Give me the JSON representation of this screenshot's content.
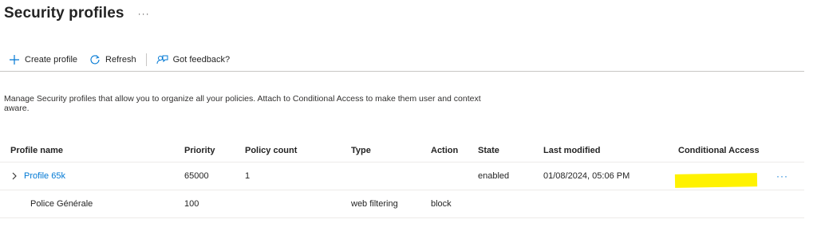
{
  "page": {
    "title": "Security profiles",
    "more_label": "···"
  },
  "toolbar": {
    "create_label": "Create profile",
    "refresh_label": "Refresh",
    "feedback_label": "Got feedback?"
  },
  "description": "Manage Security profiles that allow you to organize all your policies. Attach to Conditional Access to make them user and context aware.",
  "table": {
    "columns": [
      "Profile name",
      "Priority",
      "Policy count",
      "Type",
      "Action",
      "State",
      "Last modified",
      "Conditional Access"
    ],
    "rows": [
      {
        "name": "Profile 65k",
        "priority": "65000",
        "policy_count": "1",
        "type": "",
        "action": "",
        "state": "enabled",
        "last_modified": "01/08/2024, 05:06 PM",
        "conditional_access": "",
        "more_label": "···"
      },
      {
        "name": "Police Générale",
        "priority": "100",
        "policy_count": "",
        "type": "web filtering",
        "action": "block",
        "state": "",
        "last_modified": "",
        "conditional_access": ""
      }
    ]
  },
  "colors": {
    "accent": "#0078d4",
    "redaction": "#fff200",
    "text": "#242424",
    "divider": "#c8c6c4"
  },
  "icons": {
    "create": "plus-icon",
    "refresh": "refresh-icon",
    "feedback": "feedback-icon",
    "expand": "chevron-right-icon",
    "more": "more-icon"
  }
}
